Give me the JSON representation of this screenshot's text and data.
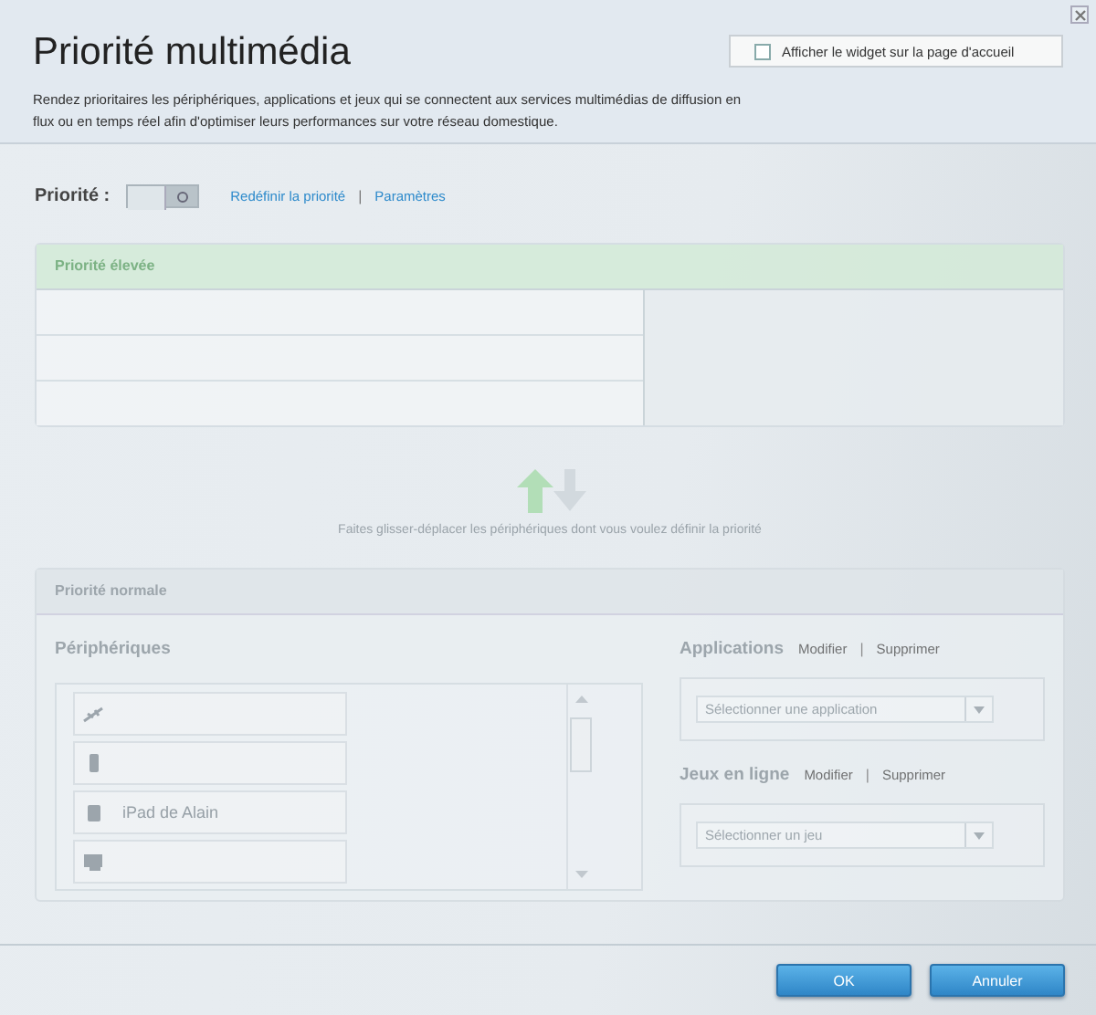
{
  "window": {
    "title": "Priorité multimédia",
    "description": "Rendez prioritaires les périphériques, applications et jeux qui se connectent aux services multimédias de diffusion en flux ou en temps réel afin d'optimiser leurs performances sur votre réseau domestique."
  },
  "widget_option": {
    "label": "Afficher le widget sur la page d'accueil",
    "checked": false
  },
  "priority": {
    "label": "Priorité :",
    "on": false,
    "separator": "|",
    "links": [
      "Redéfinir la priorité",
      "Paramètres"
    ]
  },
  "high_priority": {
    "title": "Priorité élevée"
  },
  "hint": "Faites glisser-déplacer les périphériques dont vous voulez définir la priorité",
  "normal_priority": {
    "title": "Priorité normale",
    "devices_title": "Périphériques",
    "devices": [
      {
        "kind": "network"
      },
      {
        "kind": "phone"
      },
      {
        "kind": "tablet",
        "name": "iPad de Alain"
      },
      {
        "kind": "computer"
      }
    ],
    "sections": [
      {
        "title": "Applications",
        "separator": "|",
        "links": [
          "Modifier",
          "Supprimer"
        ],
        "placeholder": "Sélectionner une application"
      },
      {
        "title": "Jeux en ligne",
        "separator": "|",
        "links": [
          "Modifier",
          "Supprimer"
        ],
        "placeholder": "Sélectionner un jeu"
      }
    ]
  },
  "buttons": [
    "OK",
    "Annuler"
  ]
}
